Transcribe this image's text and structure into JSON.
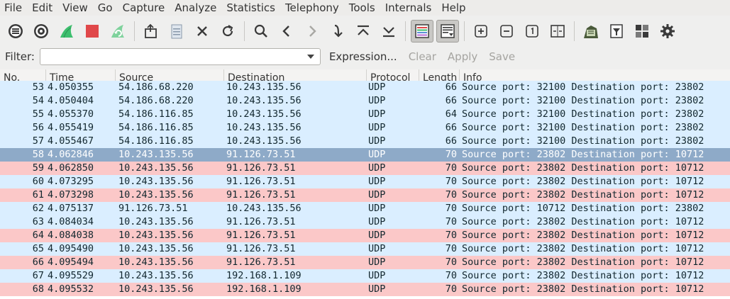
{
  "menu": [
    "File",
    "Edit",
    "View",
    "Go",
    "Capture",
    "Analyze",
    "Statistics",
    "Telephony",
    "Tools",
    "Internals",
    "Help"
  ],
  "toolbar": {
    "icons": [
      "interfaces-icon",
      "options-icon",
      "start-capture-icon",
      "stop-capture-icon",
      "restart-capture-icon",
      "open-file-icon",
      "file-set-icon",
      "close-file-icon",
      "reload-icon",
      "find-icon",
      "back-icon",
      "forward-icon",
      "go-to-packet-icon",
      "first-packet-icon",
      "last-packet-icon",
      "colorize-icon",
      "autoscroll-icon",
      "zoom-in-icon",
      "zoom-out-icon",
      "normal-size-icon",
      "resize-columns-icon",
      "capture-filters-icon",
      "display-filters-icon",
      "coloring-rules-icon",
      "preferences-icon"
    ],
    "colors": {
      "shark_fin": "#3dbf6e",
      "stop": "#e0484a",
      "colorize_on": "#c9c8c5"
    }
  },
  "filter": {
    "label": "Filter:",
    "value": "",
    "placeholder": "",
    "expression": "Expression...",
    "clear": "Clear",
    "apply": "Apply",
    "save": "Save"
  },
  "columns": [
    "No.",
    "Time",
    "Source",
    "Destination",
    "Protocol",
    "Length",
    "Info"
  ],
  "rows": [
    {
      "no": "53",
      "time": "4.050355",
      "src": "54.186.68.220",
      "dst": "10.243.135.56",
      "proto": "UDP",
      "len": "66",
      "info": "Source port: 32100  Destination port: 23802",
      "color": "blue"
    },
    {
      "no": "54",
      "time": "4.050404",
      "src": "54.186.68.220",
      "dst": "10.243.135.56",
      "proto": "UDP",
      "len": "66",
      "info": "Source port: 32100  Destination port: 23802",
      "color": "blue"
    },
    {
      "no": "55",
      "time": "4.055370",
      "src": "54.186.116.85",
      "dst": "10.243.135.56",
      "proto": "UDP",
      "len": "64",
      "info": "Source port: 32100  Destination port: 23802",
      "color": "blue"
    },
    {
      "no": "56",
      "time": "4.055419",
      "src": "54.186.116.85",
      "dst": "10.243.135.56",
      "proto": "UDP",
      "len": "66",
      "info": "Source port: 32100  Destination port: 23802",
      "color": "blue"
    },
    {
      "no": "57",
      "time": "4.055467",
      "src": "54.186.116.85",
      "dst": "10.243.135.56",
      "proto": "UDP",
      "len": "66",
      "info": "Source port: 32100  Destination port: 23802",
      "color": "blue"
    },
    {
      "no": "58",
      "time": "4.062846",
      "src": "10.243.135.56",
      "dst": "91.126.73.51",
      "proto": "UDP",
      "len": "70",
      "info": "Source port: 23802  Destination port: 10712",
      "color": "selected"
    },
    {
      "no": "59",
      "time": "4.062850",
      "src": "10.243.135.56",
      "dst": "91.126.73.51",
      "proto": "UDP",
      "len": "70",
      "info": "Source port: 23802  Destination port: 10712",
      "color": "red"
    },
    {
      "no": "60",
      "time": "4.073295",
      "src": "10.243.135.56",
      "dst": "91.126.73.51",
      "proto": "UDP",
      "len": "70",
      "info": "Source port: 23802  Destination port: 10712",
      "color": "blue"
    },
    {
      "no": "61",
      "time": "4.073298",
      "src": "10.243.135.56",
      "dst": "91.126.73.51",
      "proto": "UDP",
      "len": "70",
      "info": "Source port: 23802  Destination port: 10712",
      "color": "red"
    },
    {
      "no": "62",
      "time": "4.075137",
      "src": "91.126.73.51",
      "dst": "10.243.135.56",
      "proto": "UDP",
      "len": "70",
      "info": "Source port: 10712  Destination port: 23802",
      "color": "blue"
    },
    {
      "no": "63",
      "time": "4.084034",
      "src": "10.243.135.56",
      "dst": "91.126.73.51",
      "proto": "UDP",
      "len": "70",
      "info": "Source port: 23802  Destination port: 10712",
      "color": "blue"
    },
    {
      "no": "64",
      "time": "4.084038",
      "src": "10.243.135.56",
      "dst": "91.126.73.51",
      "proto": "UDP",
      "len": "70",
      "info": "Source port: 23802  Destination port: 10712",
      "color": "red"
    },
    {
      "no": "65",
      "time": "4.095490",
      "src": "10.243.135.56",
      "dst": "91.126.73.51",
      "proto": "UDP",
      "len": "70",
      "info": "Source port: 23802  Destination port: 10712",
      "color": "blue"
    },
    {
      "no": "66",
      "time": "4.095494",
      "src": "10.243.135.56",
      "dst": "91.126.73.51",
      "proto": "UDP",
      "len": "70",
      "info": "Source port: 23802  Destination port: 10712",
      "color": "red"
    },
    {
      "no": "67",
      "time": "4.095529",
      "src": "10.243.135.56",
      "dst": "192.168.1.109",
      "proto": "UDP",
      "len": "70",
      "info": "Source port: 23802  Destination port: 10712",
      "color": "blue"
    },
    {
      "no": "68",
      "time": "4.095532",
      "src": "10.243.135.56",
      "dst": "192.168.1.109",
      "proto": "UDP",
      "len": "70",
      "info": "Source port: 23802  Destination port: 10712",
      "color": "red"
    }
  ]
}
